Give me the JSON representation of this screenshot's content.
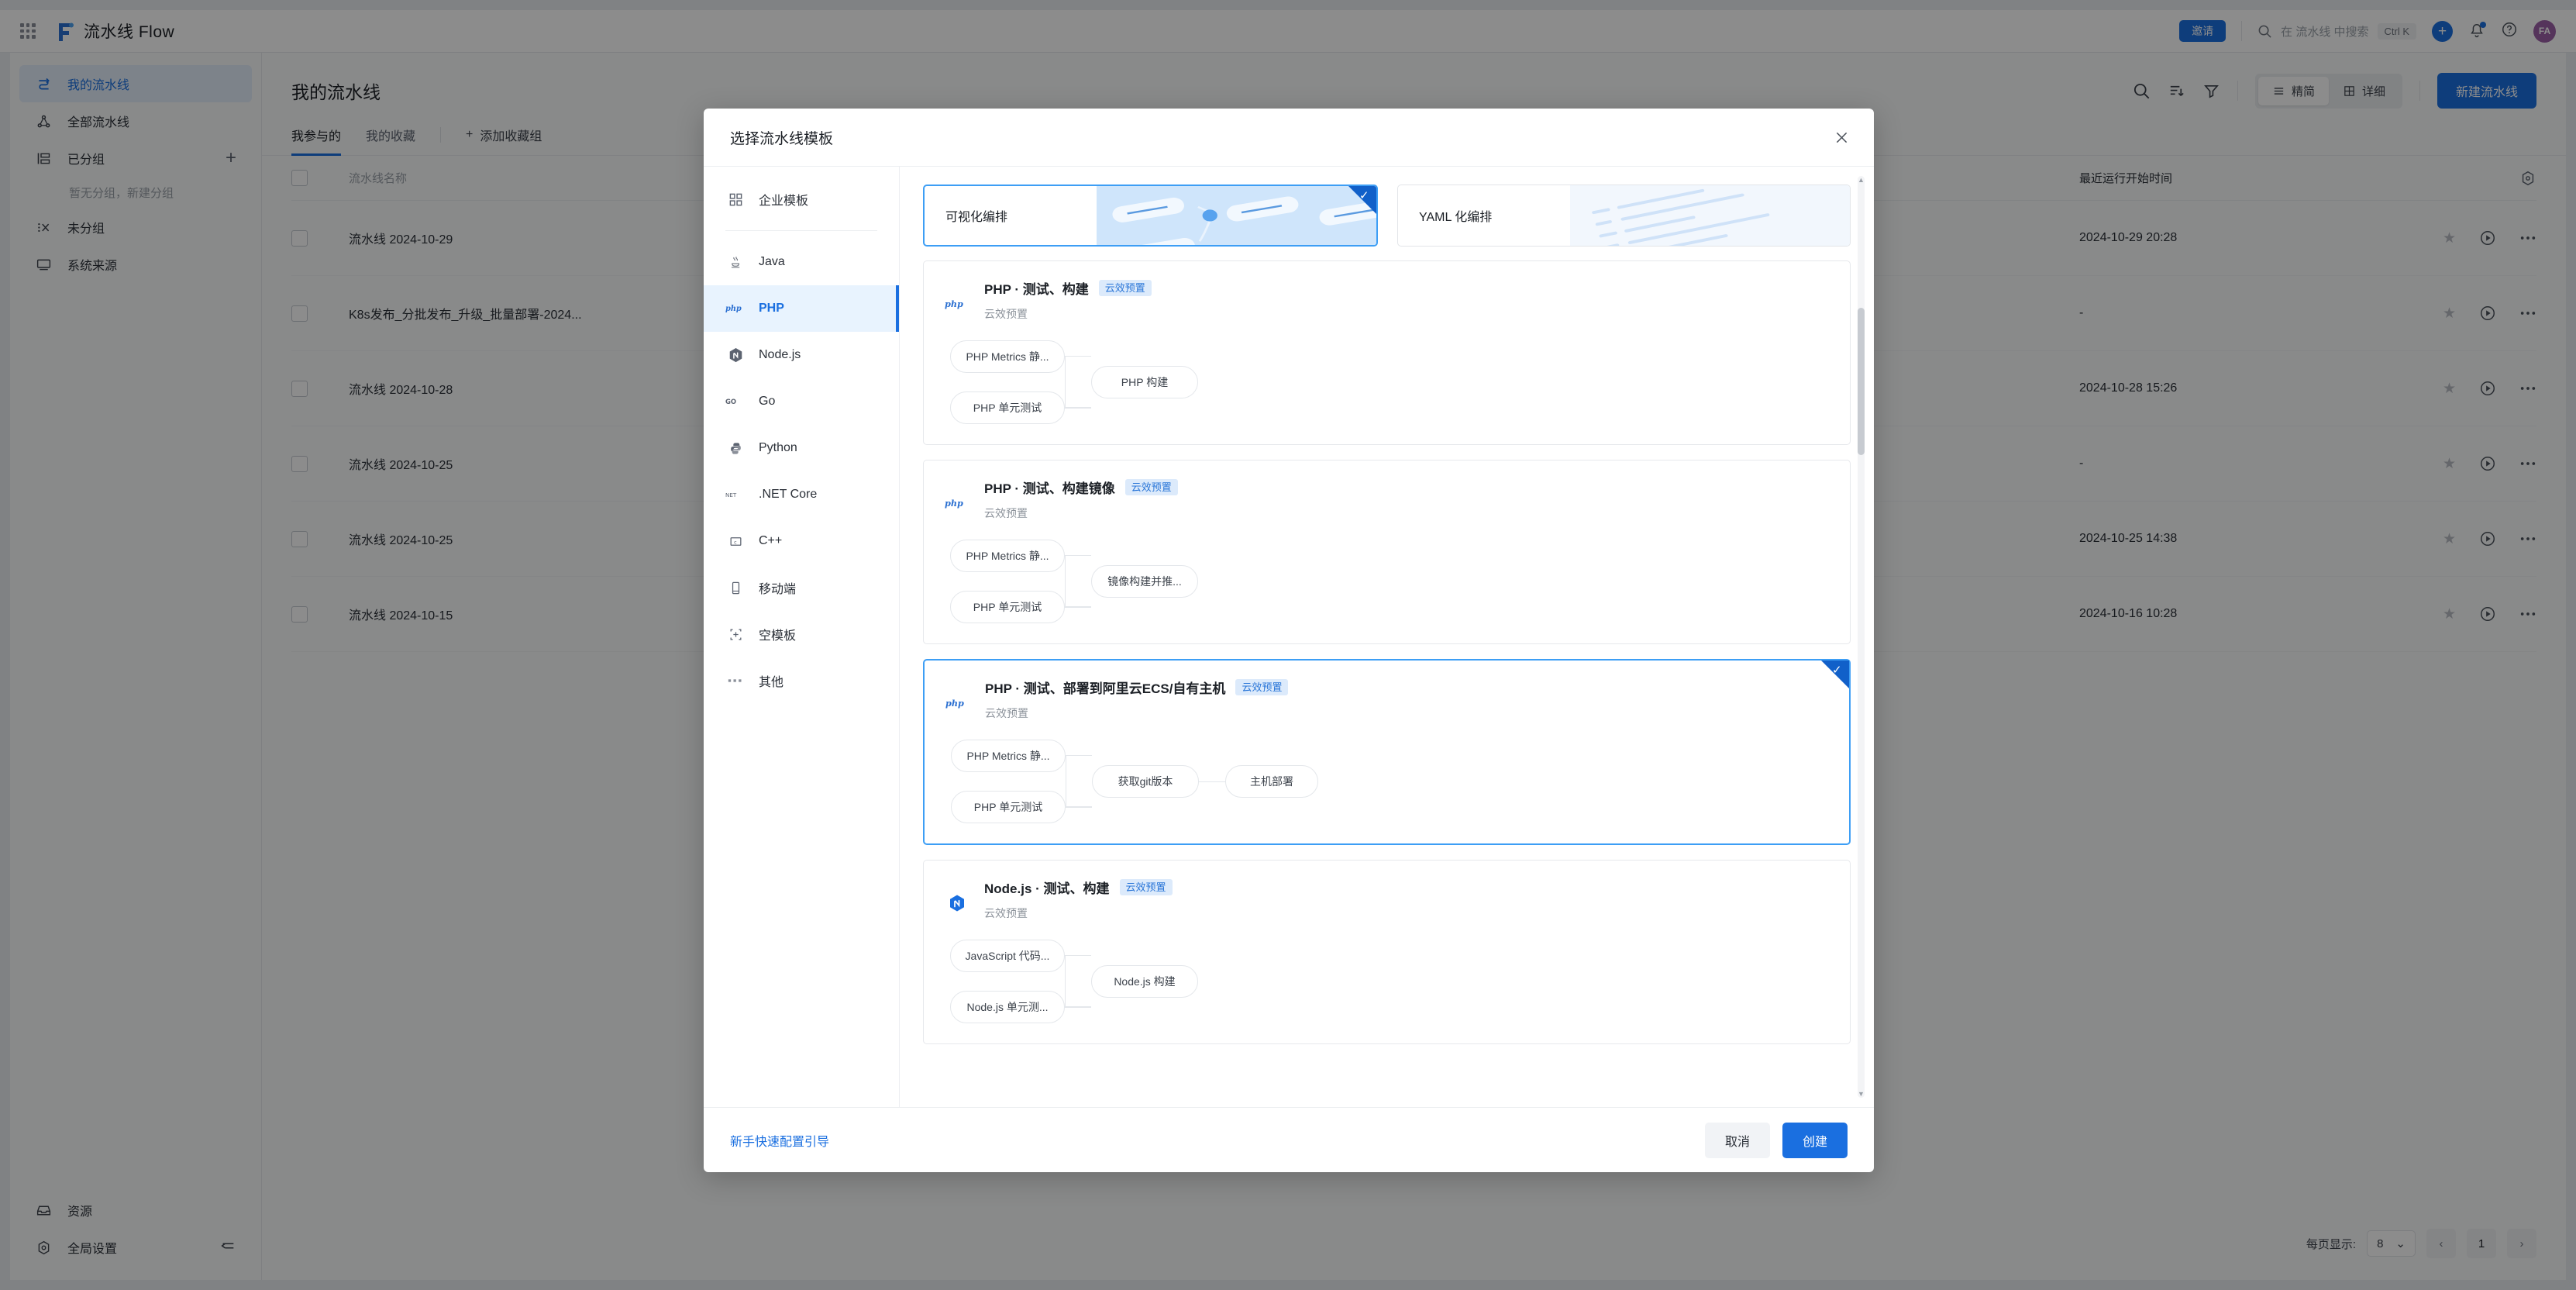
{
  "topbar": {
    "app_title": "流水线 Flow",
    "invite_label": "邀请",
    "search_placeholder": "在 流水线 中搜索",
    "shortcut": "Ctrl K",
    "avatar_initials": "FA",
    "accent_color": "#1a6fe0"
  },
  "sidebar": {
    "items": [
      {
        "label": "我的流水线",
        "icon": "pipeline-icon",
        "active": true
      },
      {
        "label": "全部流水线",
        "icon": "network-icon",
        "active": false
      },
      {
        "label": "已分组",
        "icon": "group-icon",
        "active": false,
        "has_add": true
      },
      {
        "label": "未分组",
        "icon": "ungroup-icon",
        "active": false
      },
      {
        "label": "系统来源",
        "icon": "monitor-icon",
        "active": false
      }
    ],
    "empty_group_hint": "暂无分组，新建分组",
    "bottom_items": [
      {
        "label": "资源",
        "icon": "inbox-icon"
      },
      {
        "label": "全局设置",
        "icon": "gear-icon",
        "has_collapse": true
      }
    ]
  },
  "main": {
    "page_title": "我的流水线",
    "tabs": [
      {
        "label": "我参与的",
        "active": true
      },
      {
        "label": "我的收藏",
        "active": false
      }
    ],
    "add_group_label": "添加收藏组",
    "view_modes": [
      {
        "label": "精简",
        "icon": "list-icon",
        "active": true
      },
      {
        "label": "详细",
        "icon": "grid-icon",
        "active": false
      }
    ],
    "new_pipeline_label": "新建流水线",
    "table": {
      "columns": [
        "流水线名称",
        "最近运行开始时间"
      ],
      "rows": [
        {
          "name": "流水线 2024-10-29",
          "time": "2024-10-29 20:28"
        },
        {
          "name": "K8s发布_分批发布_升级_批量部署-2024...",
          "time": "-"
        },
        {
          "name": "流水线 2024-10-28",
          "time": "2024-10-28 15:26"
        },
        {
          "name": "流水线 2024-10-25",
          "time": "-"
        },
        {
          "name": "流水线 2024-10-25",
          "time": "2024-10-25 14:38"
        },
        {
          "name": "流水线 2024-10-15",
          "time": "2024-10-16 10:28"
        }
      ]
    },
    "pagination": {
      "per_page_label": "每页显示:",
      "per_page_value": "8",
      "current_page": "1"
    }
  },
  "modal": {
    "title": "选择流水线模板",
    "categories": [
      {
        "label": "企业模板",
        "icon": "apps-icon",
        "active": false
      },
      {
        "label": "Java",
        "icon": "java-icon",
        "active": false
      },
      {
        "label": "PHP",
        "icon": "php-icon",
        "active": true
      },
      {
        "label": "Node.js",
        "icon": "nodejs-icon",
        "active": false
      },
      {
        "label": "Go",
        "icon": "go-icon",
        "active": false
      },
      {
        "label": "Python",
        "icon": "python-icon",
        "active": false
      },
      {
        "label": ".NET Core",
        "icon": "dotnet-icon",
        "active": false
      },
      {
        "label": "C++",
        "icon": "cpp-icon",
        "active": false
      },
      {
        "label": "移动端",
        "icon": "mobile-icon",
        "active": false
      },
      {
        "label": "空模板",
        "icon": "blank-template-icon",
        "active": false
      },
      {
        "label": "其他",
        "icon": "ellipsis-icon",
        "active": false
      }
    ],
    "modes": [
      {
        "label": "可视化编排",
        "selected": true
      },
      {
        "label": "YAML 化编排",
        "selected": false
      }
    ],
    "templates": [
      {
        "title": "PHP · 测试、构建",
        "badge": "云效预置",
        "subtitle": "云效预置",
        "logo": "php-icon",
        "selected": false,
        "nodes": [
          "PHP Metrics 静...",
          "PHP 单元测试",
          "PHP 构建"
        ]
      },
      {
        "title": "PHP · 测试、构建镜像",
        "badge": "云效预置",
        "subtitle": "云效预置",
        "logo": "php-icon",
        "selected": false,
        "nodes": [
          "PHP Metrics 静...",
          "PHP 单元测试",
          "镜像构建并推..."
        ]
      },
      {
        "title": "PHP · 测试、部署到阿里云ECS/自有主机",
        "badge": "云效预置",
        "subtitle": "云效预置",
        "logo": "php-icon",
        "selected": true,
        "nodes": [
          "PHP Metrics 静...",
          "PHP 单元测试",
          "获取git版本",
          "主机部署"
        ]
      },
      {
        "title": "Node.js · 测试、构建",
        "badge": "云效预置",
        "subtitle": "云效预置",
        "logo": "nodejs-icon",
        "selected": false,
        "nodes": [
          "JavaScript 代码...",
          "Node.js 单元测...",
          "Node.js 构建"
        ]
      }
    ],
    "footer": {
      "guide_link": "新手快速配置引导",
      "cancel_label": "取消",
      "create_label": "创建"
    }
  }
}
